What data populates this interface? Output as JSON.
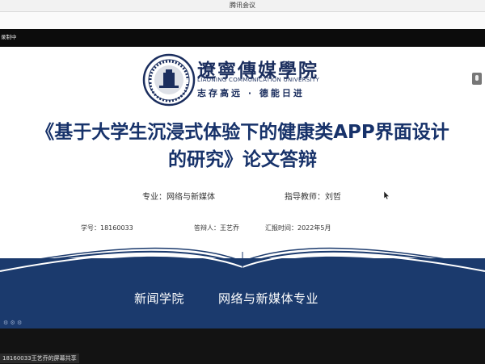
{
  "window": {
    "title": "腾讯会议"
  },
  "recording": {
    "label": "录制中"
  },
  "slide": {
    "university_cn": "遼寧傳媒學院",
    "university_en": "LIAONING COMMUNICATION UNIVERSITY",
    "motto": "志存高远 · 德能日进",
    "title_line1": "《基于大学生沉浸式体验下的健康类APP界面设计",
    "title_line2": "的研究》论文答辩",
    "major": "专业：网络与新媒体",
    "advisor": "指导教师：刘哲",
    "student_id": "学号：18160033",
    "presenter": "答辩人：王艺乔",
    "report_time": "汇报时间：2022年5月",
    "college": "新闻学院",
    "program": "网络与新媒体专业"
  },
  "share": {
    "label": "18160033王艺乔的屏幕共享"
  },
  "colors": {
    "navy": "#1b3a6d",
    "title_blue": "#17326a",
    "logo_blue": "#1b2e5e"
  }
}
